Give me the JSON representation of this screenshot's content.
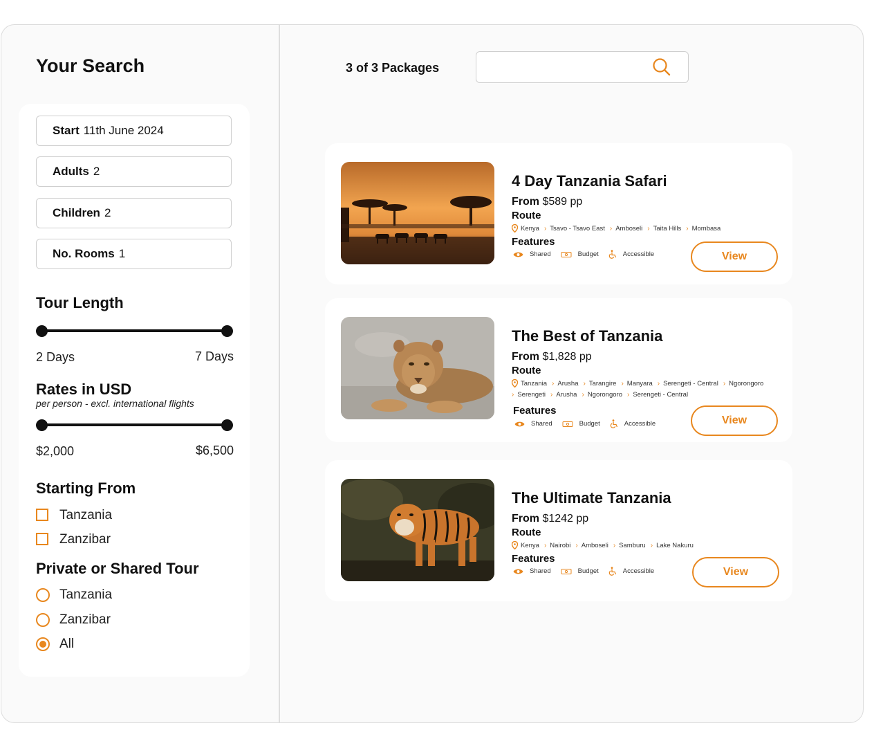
{
  "sidebar": {
    "title": "Your Search",
    "fields": [
      {
        "label": "Start",
        "value": "11th June 2024"
      },
      {
        "label": "Adults",
        "value": "2"
      },
      {
        "label": "Children",
        "value": "2"
      },
      {
        "label": "No. Rooms",
        "value": "1"
      }
    ],
    "tour_length": {
      "title": "Tour Length",
      "min_label": "2 Days",
      "max_label": "7 Days"
    },
    "rates": {
      "title": "Rates in USD",
      "subtitle": "per person - excl. international flights",
      "min_label": "$2,000",
      "max_label": "$6,500"
    },
    "starting_from": {
      "title": "Starting From",
      "options": [
        {
          "label": "Tanzania",
          "checked": false
        },
        {
          "label": "Zanzibar",
          "checked": false
        }
      ]
    },
    "tour_type": {
      "title": "Private or Shared Tour",
      "options": [
        {
          "label": "Tanzania",
          "selected": false
        },
        {
          "label": "Zanzibar",
          "selected": false
        },
        {
          "label": "All",
          "selected": true
        }
      ]
    }
  },
  "results": {
    "count_label": "3 of 3 Packages",
    "search_placeholder": "",
    "accent_color": "#e8871e"
  },
  "packages": [
    {
      "name": "4 Day Tanzania Safari",
      "price_prefix": "From",
      "price": "$589 pp",
      "route_label": "Route",
      "route": [
        "Kenya",
        "Tsavo - Tsavo East",
        "Amboseli",
        "Taita Hills",
        "Mombasa"
      ],
      "features_label": "Features",
      "features": [
        "Shared",
        "Budget",
        "Accessible"
      ],
      "view_label": "View",
      "image": "sunset-safari-zebras"
    },
    {
      "name": "The Best of Tanzania",
      "price_prefix": "From",
      "price": "$1,828 pp",
      "route_label": "Route",
      "route": [
        "Tanzania",
        "Arusha",
        "Tarangire",
        "Manyara",
        "Serengeti - Central",
        "Ngorongoro",
        "Serengeti",
        "Arusha",
        "Ngorongoro",
        "Serengeti - Central"
      ],
      "features_label": "Features",
      "features": [
        "Shared",
        "Budget",
        "Accessible"
      ],
      "view_label": "View",
      "image": "lioness"
    },
    {
      "name": "The Ultimate Tanzania",
      "price_prefix": "From",
      "price": "$1242 pp",
      "route_label": "Route",
      "route": [
        "Kenya",
        "Nairobi",
        "Amboseli",
        "Samburu",
        "Lake Nakuru"
      ],
      "features_label": "Features",
      "features": [
        "Shared",
        "Budget",
        "Accessible"
      ],
      "view_label": "View",
      "image": "tiger"
    }
  ]
}
